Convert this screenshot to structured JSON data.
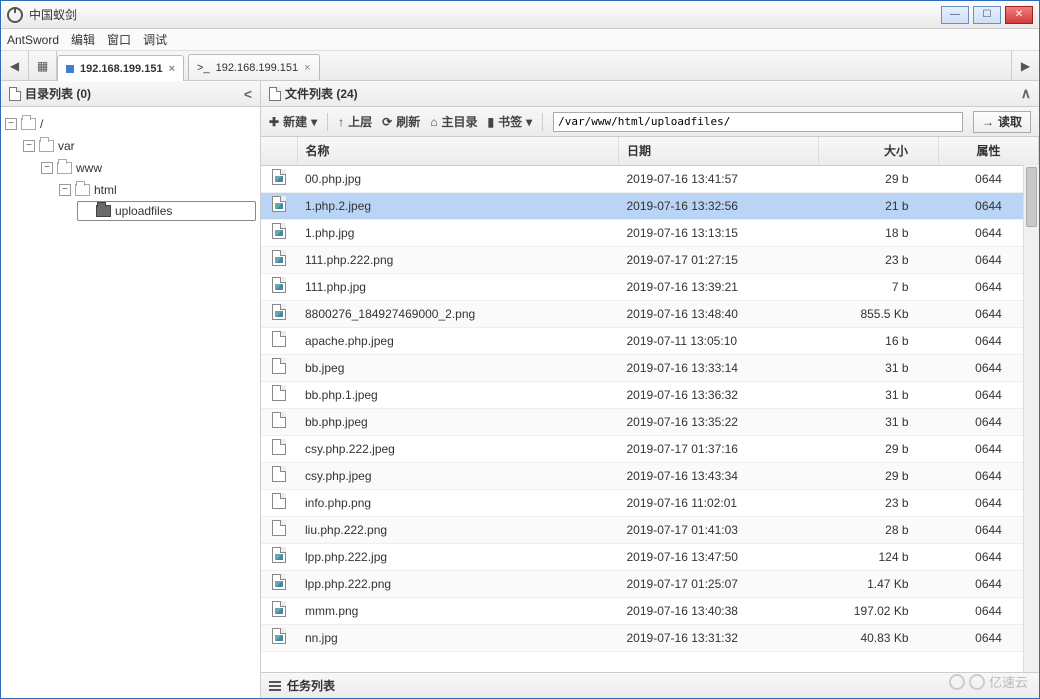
{
  "window": {
    "title": "中国蚁剑"
  },
  "menu": {
    "items": [
      "AntSword",
      "编辑",
      "窗口",
      "调试"
    ]
  },
  "tabs": {
    "active": {
      "label": "192.168.199.151"
    },
    "second": {
      "prefix": ">_",
      "label": "192.168.199.151"
    }
  },
  "sidebar": {
    "title": "目录列表 (0)",
    "tree": {
      "root": "/",
      "l1": "var",
      "l2": "www",
      "l3": "html",
      "l4": "uploadfiles"
    }
  },
  "filelist": {
    "title": "文件列表 (24)",
    "toolbar": {
      "new": "新建",
      "up": "上层",
      "refresh": "刷新",
      "home": "主目录",
      "bookmark": "书签",
      "read": "读取"
    },
    "path": "/var/www/html/uploadfiles/",
    "columns": {
      "name": "名称",
      "date": "日期",
      "size": "大小",
      "attr": "属性"
    },
    "rows": [
      {
        "name": "00.php.jpg",
        "date": "2019-07-16 13:41:57",
        "size": "29 b",
        "attr": "0644",
        "img": true
      },
      {
        "name": "1.php.2.jpeg",
        "date": "2019-07-16 13:32:56",
        "size": "21 b",
        "attr": "0644",
        "img": true,
        "selected": true
      },
      {
        "name": "1.php.jpg",
        "date": "2019-07-16 13:13:15",
        "size": "18 b",
        "attr": "0644",
        "img": true
      },
      {
        "name": "111.php.222.png",
        "date": "2019-07-17 01:27:15",
        "size": "23 b",
        "attr": "0644",
        "img": true
      },
      {
        "name": "111.php.jpg",
        "date": "2019-07-16 13:39:21",
        "size": "7 b",
        "attr": "0644",
        "img": true
      },
      {
        "name": "8800276_184927469000_2.png",
        "date": "2019-07-16 13:48:40",
        "size": "855.5 Kb",
        "attr": "0644",
        "img": true
      },
      {
        "name": "apache.php.jpeg",
        "date": "2019-07-11 13:05:10",
        "size": "16 b",
        "attr": "0644",
        "img": false
      },
      {
        "name": "bb.jpeg",
        "date": "2019-07-16 13:33:14",
        "size": "31 b",
        "attr": "0644",
        "img": false
      },
      {
        "name": "bb.php.1.jpeg",
        "date": "2019-07-16 13:36:32",
        "size": "31 b",
        "attr": "0644",
        "img": false
      },
      {
        "name": "bb.php.jpeg",
        "date": "2019-07-16 13:35:22",
        "size": "31 b",
        "attr": "0644",
        "img": false
      },
      {
        "name": "csy.php.222.jpeg",
        "date": "2019-07-17 01:37:16",
        "size": "29 b",
        "attr": "0644",
        "img": false
      },
      {
        "name": "csy.php.jpeg",
        "date": "2019-07-16 13:43:34",
        "size": "29 b",
        "attr": "0644",
        "img": false
      },
      {
        "name": "info.php.png",
        "date": "2019-07-16 11:02:01",
        "size": "23 b",
        "attr": "0644",
        "img": false
      },
      {
        "name": "liu.php.222.png",
        "date": "2019-07-17 01:41:03",
        "size": "28 b",
        "attr": "0644",
        "img": false
      },
      {
        "name": "lpp.php.222.jpg",
        "date": "2019-07-16 13:47:50",
        "size": "124 b",
        "attr": "0644",
        "img": true
      },
      {
        "name": "lpp.php.222.png",
        "date": "2019-07-17 01:25:07",
        "size": "1.47 Kb",
        "attr": "0644",
        "img": true
      },
      {
        "name": "mmm.png",
        "date": "2019-07-16 13:40:38",
        "size": "197.02 Kb",
        "attr": "0644",
        "img": true
      },
      {
        "name": "nn.jpg",
        "date": "2019-07-16 13:31:32",
        "size": "40.83 Kb",
        "attr": "0644",
        "img": true
      }
    ]
  },
  "tasklist": {
    "title": "任务列表"
  },
  "watermark": "亿速云"
}
